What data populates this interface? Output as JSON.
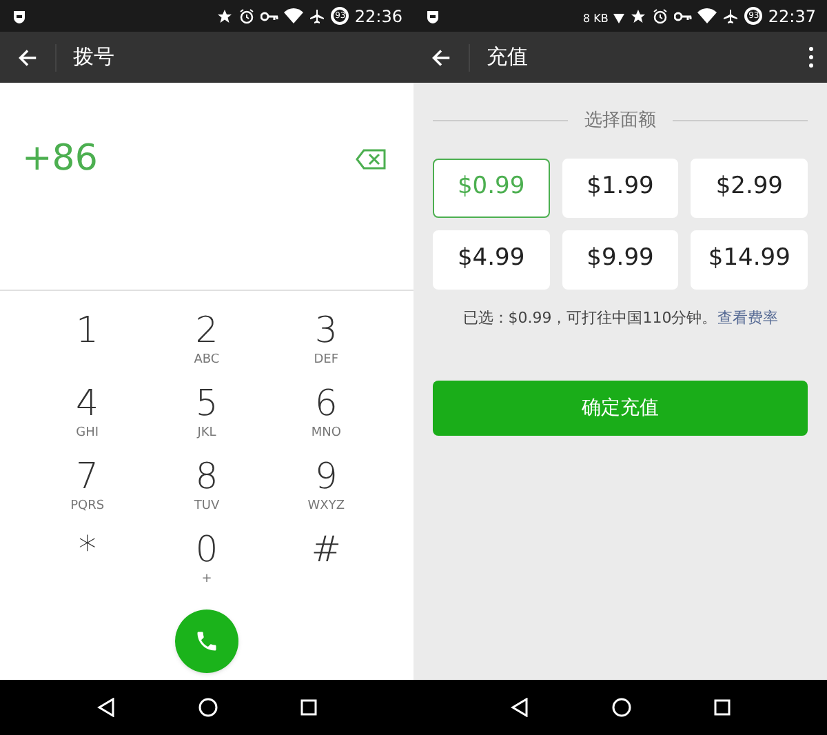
{
  "screens": [
    {
      "kind": "dialer",
      "status_bar": {
        "battery": "93",
        "time": "22:36"
      },
      "toolbar": {
        "title": "拨号",
        "menu": false
      },
      "dialer": {
        "number": "+86",
        "keys": [
          {
            "digit": "1"
          },
          {
            "digit": "2",
            "letters": "ABC"
          },
          {
            "digit": "3",
            "letters": "DEF"
          },
          {
            "digit": "4",
            "letters": "GHI"
          },
          {
            "digit": "5",
            "letters": "JKL"
          },
          {
            "digit": "6",
            "letters": "MNO"
          },
          {
            "digit": "7",
            "letters": "PQRS"
          },
          {
            "digit": "8",
            "letters": "TUV"
          },
          {
            "digit": "9",
            "letters": "WXYZ"
          },
          {
            "digit": "*"
          },
          {
            "digit": "0",
            "letters": "+"
          },
          {
            "digit": "#"
          }
        ]
      }
    },
    {
      "kind": "recharge",
      "status_bar": {
        "network_speed": "8 KB",
        "battery": "93",
        "time": "22:37"
      },
      "toolbar": {
        "title": "充值",
        "menu": true
      },
      "recharge": {
        "section_title": "选择面额",
        "amounts": [
          {
            "label": "$0.99",
            "selected": true
          },
          {
            "label": "$1.99",
            "selected": false
          },
          {
            "label": "$2.99",
            "selected": false
          },
          {
            "label": "$4.99",
            "selected": false
          },
          {
            "label": "$9.99",
            "selected": false
          },
          {
            "label": "$14.99",
            "selected": false
          }
        ],
        "summary": "已选：$0.99，可打往中国110分钟。",
        "rates_link": "查看费率",
        "confirm_button": "确定充值"
      }
    }
  ]
}
